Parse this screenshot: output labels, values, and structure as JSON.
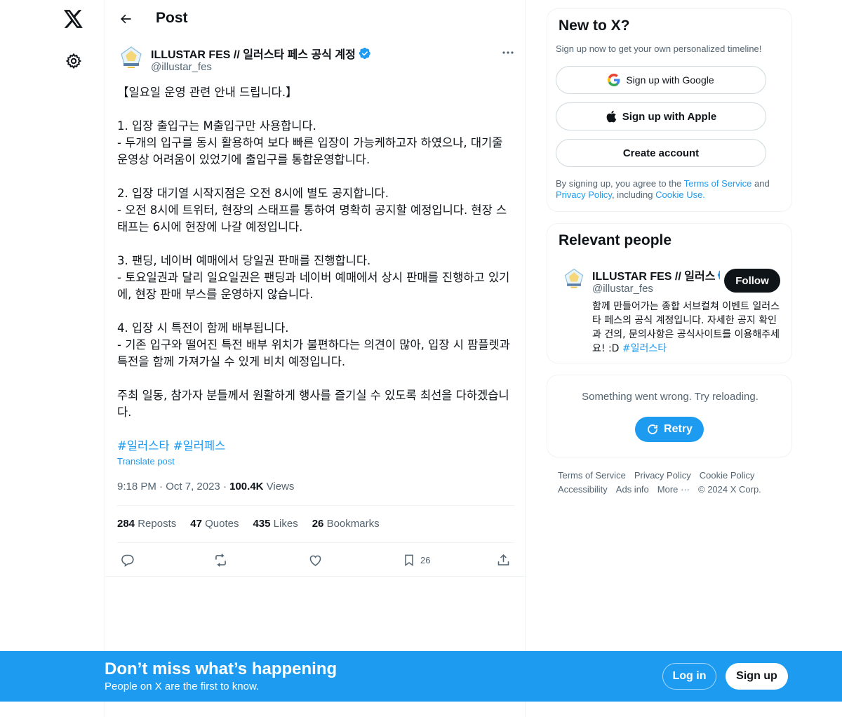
{
  "header": {
    "title": "Post"
  },
  "post": {
    "author_name": "ILLUSTAR FES // 일러스타 페스 공식 계정",
    "author_handle": "@illustar_fes",
    "text": "【일요일 운영 관련 안내 드립니다.】\n\n1. 입장 출입구는 M출입구만 사용합니다.\n- 두개의 입구를 동시 활용하여 보다 빠른 입장이 가능케하고자 하였으나, 대기줄 운영상 어려움이 있었기에 출입구를 통합운영합니다.\n\n2. 입장 대기열 시작지점은 오전 8시에 별도 공지합니다.\n- 오전 8시에 트위터, 현장의 스태프를 통하여 명확히 공지할 예정입니다. 현장 스태프는 6시에 현장에 나갈 예정입니다.\n\n3. 팬딩, 네이버 예매에서 당일권 판매를 진행합니다.\n- 토요일권과 달리 일요일권은 팬딩과 네이버 예매에서 상시 판매를 진행하고 있기에, 현장 판매 부스를 운영하지 않습니다.\n\n4. 입장 시 특전이 함께 배부됩니다.\n- 기존 입구와 떨어진 특전 배부 위치가 불편하다는 의견이 많아, 입장 시 팜플렛과 특전을 함께 가져가실 수 있게 비치 예정입니다.\n\n주최 일동, 참가자 분들께서 원활하게 행사를 즐기실 수 있도록 최선을 다하겠습니다.",
    "hashtags": [
      "#일러스타",
      "#일러페스"
    ],
    "translate_label": "Translate post",
    "time": "9:18 PM",
    "date": "Oct 7, 2023",
    "views": "100.4K",
    "views_label": "Views",
    "stats": {
      "reposts": "284",
      "reposts_label": "Reposts",
      "quotes": "47",
      "quotes_label": "Quotes",
      "likes": "435",
      "likes_label": "Likes",
      "bookmarks": "26",
      "bookmarks_label": "Bookmarks"
    },
    "bookmark_count": "26"
  },
  "signup_card": {
    "title": "New to X?",
    "subtitle": "Sign up now to get your own personalized timeline!",
    "google_label": "Sign up with Google",
    "apple_label": "Sign up with Apple",
    "create_label": "Create account",
    "legal_prefix": "By signing up, you agree to the ",
    "terms_label": "Terms of Service",
    "legal_and": " and ",
    "privacy_label": "Privacy Policy",
    "legal_including": ", including ",
    "cookie_label": "Cookie Use."
  },
  "relevant": {
    "title": "Relevant people",
    "name": "ILLUSTAR FES // 일러스",
    "handle": "@illustar_fes",
    "follow_label": "Follow",
    "bio": "함께 만들어가는 종합 서브컬쳐 이벤트 일러스타 페스의 공식 계정입니다. 자세한 공지 확인과 건의, 문의사항은 공식사이트를 이용해주세요! :D ",
    "bio_tag": "#일러스타"
  },
  "error_card": {
    "message": "Something went wrong. Try reloading.",
    "retry_label": "Retry"
  },
  "footer": {
    "terms": "Terms of Service",
    "privacy": "Privacy Policy",
    "cookie": "Cookie Policy",
    "accessibility": "Accessibility",
    "ads": "Ads info",
    "more": "More ···",
    "copyright": "© 2024 X Corp."
  },
  "bottom_bar": {
    "title": "Don’t miss what’s happening",
    "subtitle": "People on X are the first to know.",
    "login_label": "Log in",
    "signup_label": "Sign up"
  },
  "colors": {
    "accent": "#1d9bf0",
    "text": "#0f1419",
    "muted": "#536471",
    "border": "#eff3f4"
  },
  "icons": [
    "x-logo-icon",
    "gear-icon",
    "back-arrow-icon",
    "verified-badge-icon",
    "more-icon",
    "reply-icon",
    "repost-icon",
    "like-icon",
    "bookmark-icon",
    "share-icon",
    "google-icon",
    "apple-icon",
    "refresh-icon"
  ]
}
